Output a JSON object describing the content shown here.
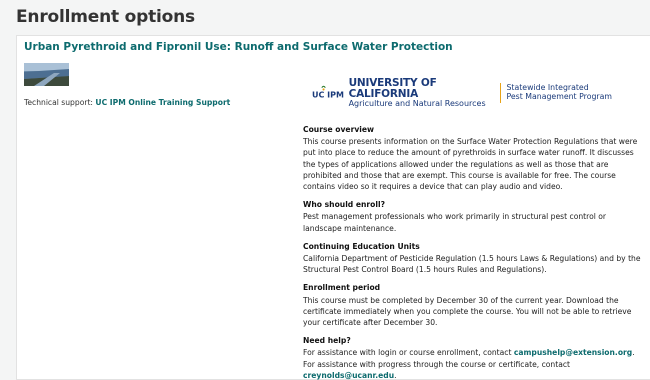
{
  "page": {
    "title": "Enrollment options"
  },
  "course": {
    "title": "Urban Pyrethroid and Fipronil Use: Runoff and Surface Water Protection",
    "support_label": "Technical support:",
    "support_link": "UC IPM Online Training Support"
  },
  "logo": {
    "ucipm": "UC IPM",
    "uc_line1": "UNIVERSITY OF CALIFORNIA",
    "uc_line2": "Agriculture and Natural Resources",
    "sip_line1": "Statewide Integrated",
    "sip_line2": "Pest Management Program"
  },
  "sections": {
    "overview": {
      "heading": "Course overview",
      "body": "This course presents information on the Surface Water Protection Regulations that were put into place to reduce the amount of pyrethroids in surface water runoff. It discusses the types of applications allowed under the regulations as well as those that are prohibited and those that are exempt. This course is available for free. The course contains video so it requires a device that can play audio and video."
    },
    "who": {
      "heading": "Who should enroll?",
      "body": "Pest management professionals who work primarily in structural pest control or landscape maintenance."
    },
    "ceu": {
      "heading": "Continuing Education Units",
      "body": "California Department of Pesticide Regulation (1.5 hours Laws & Regulations) and by the Structural Pest Control Board (1.5 hours Rules and Regulations)."
    },
    "period": {
      "heading": "Enrollment period",
      "body": "This course must be completed by December 30 of the current year. Download the certificate immediately when you complete the course. You will not be able to retrieve your certificate after December 30."
    },
    "help": {
      "heading": "Need help?",
      "text1": "For assistance with login or course enrollment, contact ",
      "email1": "campushelp@extension.org",
      "text2": ". For assistance with progress through the course or certificate, contact ",
      "email2": "creynolds@ucanr.edu",
      "text3": "."
    }
  }
}
